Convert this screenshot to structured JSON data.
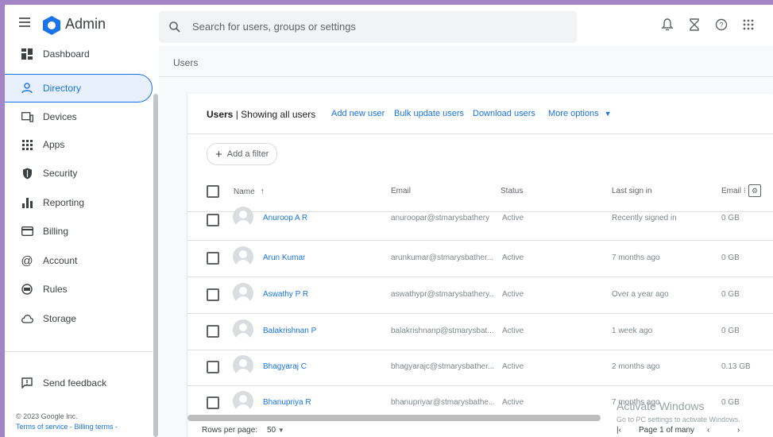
{
  "header": {
    "app_title": "Admin",
    "search_placeholder": "Search for users, groups or settings",
    "icons": [
      "menu-icon",
      "bell-icon",
      "hourglass-icon",
      "help-icon",
      "apps-grid-icon"
    ]
  },
  "sidebar": {
    "items": [
      {
        "label": "Dashboard",
        "icon": "dashboard-icon"
      },
      {
        "label": "Directory",
        "icon": "person-icon",
        "active": true
      },
      {
        "label": "Devices",
        "icon": "devices-icon"
      },
      {
        "label": "Apps",
        "icon": "apps-icon"
      },
      {
        "label": "Security",
        "icon": "shield-icon"
      },
      {
        "label": "Reporting",
        "icon": "bar-chart-icon"
      },
      {
        "label": "Billing",
        "icon": "credit-card-icon"
      },
      {
        "label": "Account",
        "icon": "at-sign-icon"
      },
      {
        "label": "Rules",
        "icon": "rules-icon"
      },
      {
        "label": "Storage",
        "icon": "cloud-icon"
      }
    ],
    "send_feedback": "Send feedback",
    "copyright": "© 2023 Google Inc.",
    "footer_links": "Terms of service - Billing terms -"
  },
  "breadcrumb": "Users",
  "toolbar": {
    "title_bold": "Users",
    "title_rest": " | Showing all users",
    "add_new_user": "Add new user",
    "bulk_update": "Bulk update users",
    "download": "Download users",
    "more_options": "More options",
    "add_filter": "Add a filter"
  },
  "table": {
    "columns": [
      "Name",
      "Email",
      "Status",
      "Last sign in",
      "Email"
    ],
    "rows": [
      {
        "name": "Anuroop A R",
        "email": "anuroopar@stmarysbathery",
        "status": "Active",
        "last_sign_in": "Recently signed in",
        "storage": "0 GB"
      },
      {
        "name": "Arun Kumar",
        "email": "arunkumar@stmarysbather...",
        "status": "Active",
        "last_sign_in": "7 months ago",
        "storage": "0 GB"
      },
      {
        "name": "Aswathy P R",
        "email": "aswathypr@stmarysbathery...",
        "status": "Active",
        "last_sign_in": "Over a year ago",
        "storage": "0 GB"
      },
      {
        "name": "Balakrishnan P",
        "email": "balakrishnanp@stmarysbat...",
        "status": "Active",
        "last_sign_in": "1 week ago",
        "storage": "0 GB"
      },
      {
        "name": "Bhagyaraj C",
        "email": "bhagyarajc@stmarysbather...",
        "status": "Active",
        "last_sign_in": "2 months ago",
        "storage": "0.13 GB"
      },
      {
        "name": "Bhanupriya R",
        "email": "bhanupriyar@stmarysbathe...",
        "status": "Active",
        "last_sign_in": "7 months ago",
        "storage": "0 GB"
      }
    ]
  },
  "pagination": {
    "rows_per_page_label": "Rows per page:",
    "rows_per_page": "50",
    "page_label": "Page 1 of many"
  },
  "watermark": {
    "line1": "Activate Windows",
    "line2": "Go to PC settings to activate Windows."
  },
  "colors": {
    "accent": "#1a73e8",
    "active_bg": "#e8f0fe",
    "frame": "#a385c7"
  }
}
